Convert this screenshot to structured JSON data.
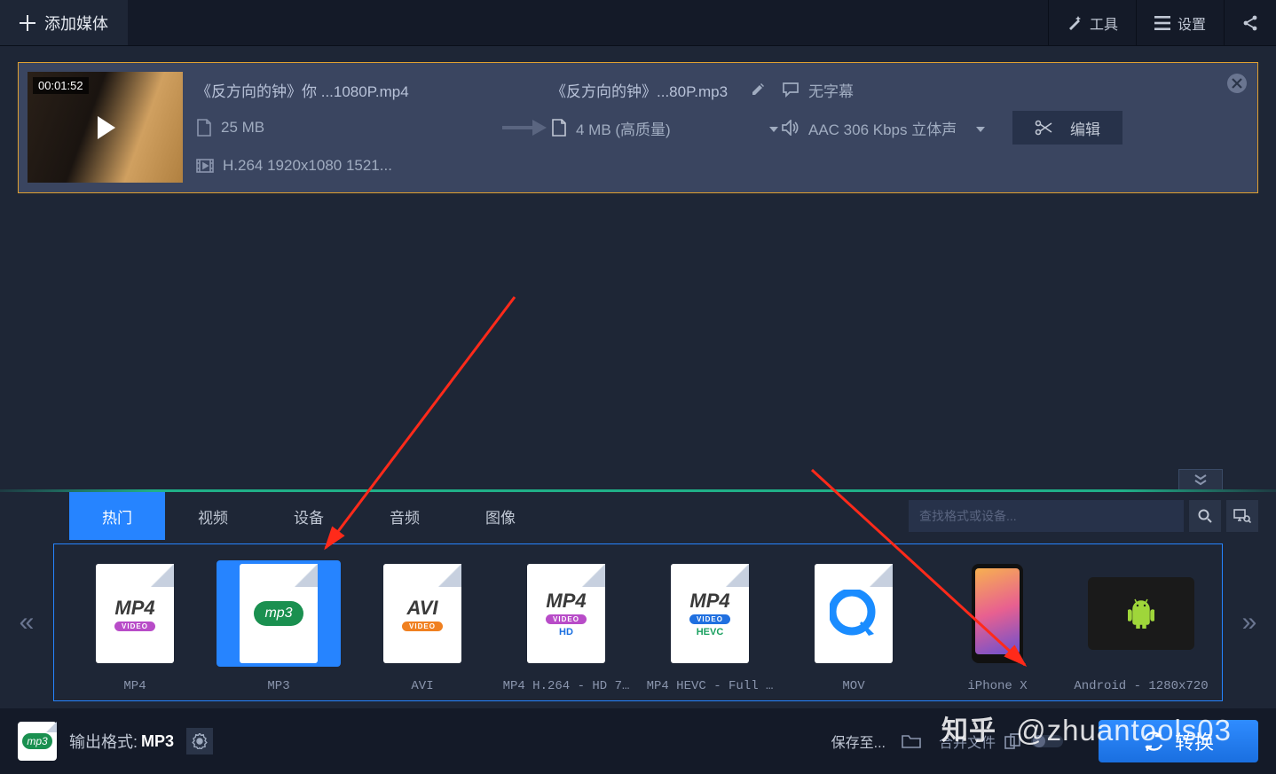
{
  "toolbar": {
    "add_media": "添加媒体",
    "tools": "工具",
    "settings": "设置"
  },
  "media_item": {
    "timestamp": "00:01:52",
    "source_name": "《反方向的钟》你 ...1080P.mp4",
    "source_size": "25 MB",
    "source_codec": "H.264 1920x1080 1521...",
    "target_name": "《反方向的钟》...80P.mp3",
    "target_size": "4 MB (高质量)",
    "subtitle_label": "无字幕",
    "audio_info": "AAC 306 Kbps 立体声",
    "edit_label": "编辑"
  },
  "tabs": {
    "items": [
      "热门",
      "视频",
      "设备",
      "音频",
      "图像"
    ],
    "active_index": 0,
    "search_placeholder": "查找格式或设备..."
  },
  "formats": [
    {
      "label": "MP4"
    },
    {
      "label": "MP3"
    },
    {
      "label": "AVI"
    },
    {
      "label": "MP4 H.264 - HD 7…"
    },
    {
      "label": "MP4 HEVC - Full …"
    },
    {
      "label": "MOV"
    },
    {
      "label": "iPhone X"
    },
    {
      "label": "Android - 1280x720"
    }
  ],
  "footer": {
    "output_label": "输出格式:",
    "output_value": "MP3",
    "save_to": "保存至...",
    "merge": "合并文件",
    "convert": "转换"
  },
  "watermark": "知乎 @zhuantools03"
}
